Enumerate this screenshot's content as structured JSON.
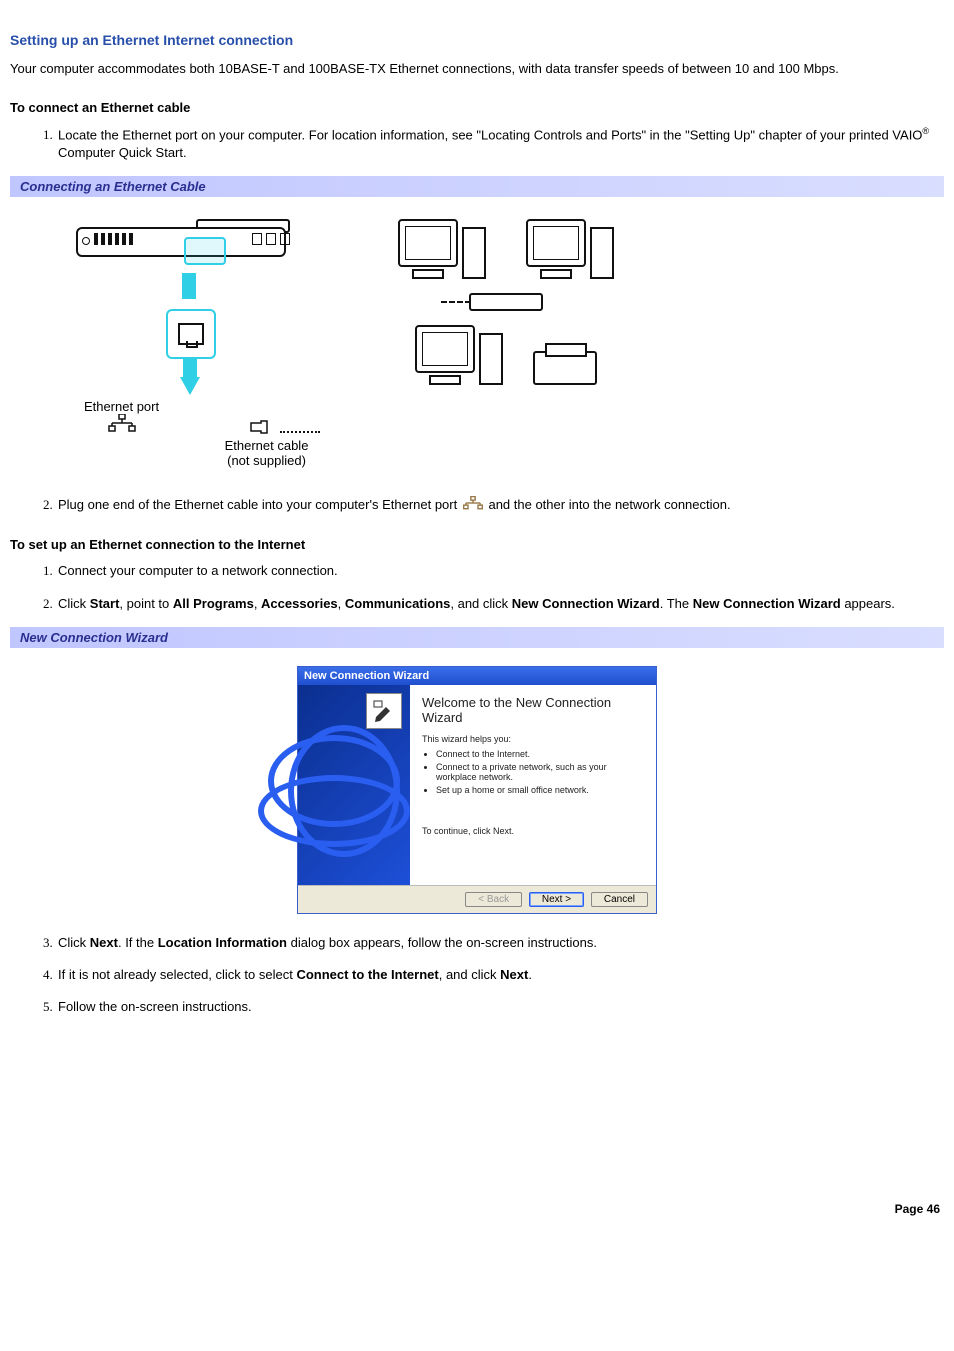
{
  "title": "Setting up an Ethernet Internet connection",
  "intro": "Your computer accommodates both 10BASE-T and 100BASE-TX Ethernet connections, with data transfer speeds of between 10 and 100 Mbps.",
  "section1_title": "To connect an Ethernet cable",
  "section1_step1_a": "Locate the Ethernet port on your computer. For location information, see \"Locating Controls and Ports\" in the \"Setting Up\" chapter of your printed VAIO",
  "section1_step1_b": " Computer Quick Start.",
  "reg_mark": "®",
  "callout1": "Connecting an Ethernet Cable",
  "fig1_label1": "Ethernet port",
  "fig1_label2a": "Ethernet cable",
  "fig1_label2b": "(not supplied)",
  "section1_step2_a": "Plug one end of the Ethernet cable into your computer's Ethernet port ",
  "section1_step2_b": "and the other into the network connection.",
  "section2_title": "To set up an Ethernet connection to the Internet",
  "section2_step1": "Connect your computer to a network connection.",
  "section2_step2_a": "Click ",
  "section2_step2_b": ", point to ",
  "section2_step2_c": ", ",
  "section2_step2_d": ", ",
  "section2_step2_e": ", and click ",
  "section2_step2_f": ". The ",
  "section2_step2_g": " appears.",
  "bold_start": "Start",
  "bold_allprog": "All Programs",
  "bold_access": "Accessories",
  "bold_comm": "Communications",
  "bold_ncw": "New Connection Wizard",
  "bold_ncw2": "New Connection Wizard",
  "callout2": "New Connection Wizard",
  "wizard": {
    "titlebar": "New Connection Wizard",
    "heading": "Welcome to the New Connection Wizard",
    "helps": "This wizard helps you:",
    "b1": "Connect to the Internet.",
    "b2": "Connect to a private network, such as your workplace network.",
    "b3": "Set up a home or small office network.",
    "continue": "To continue, click Next.",
    "back": "< Back",
    "next": "Next >",
    "cancel": "Cancel"
  },
  "section2_step3_a": "Click ",
  "section2_step3_b": ". If the ",
  "section2_step3_c": " dialog box appears, follow the on-screen instructions.",
  "bold_next": "Next",
  "bold_locinfo": "Location Information",
  "section2_step4_a": "If it is not already selected, click to select ",
  "section2_step4_b": ", and click ",
  "section2_step4_c": ".",
  "bold_connect": "Connect to the Internet",
  "section2_step5": "Follow the on-screen instructions.",
  "page_footer": "Page 46"
}
